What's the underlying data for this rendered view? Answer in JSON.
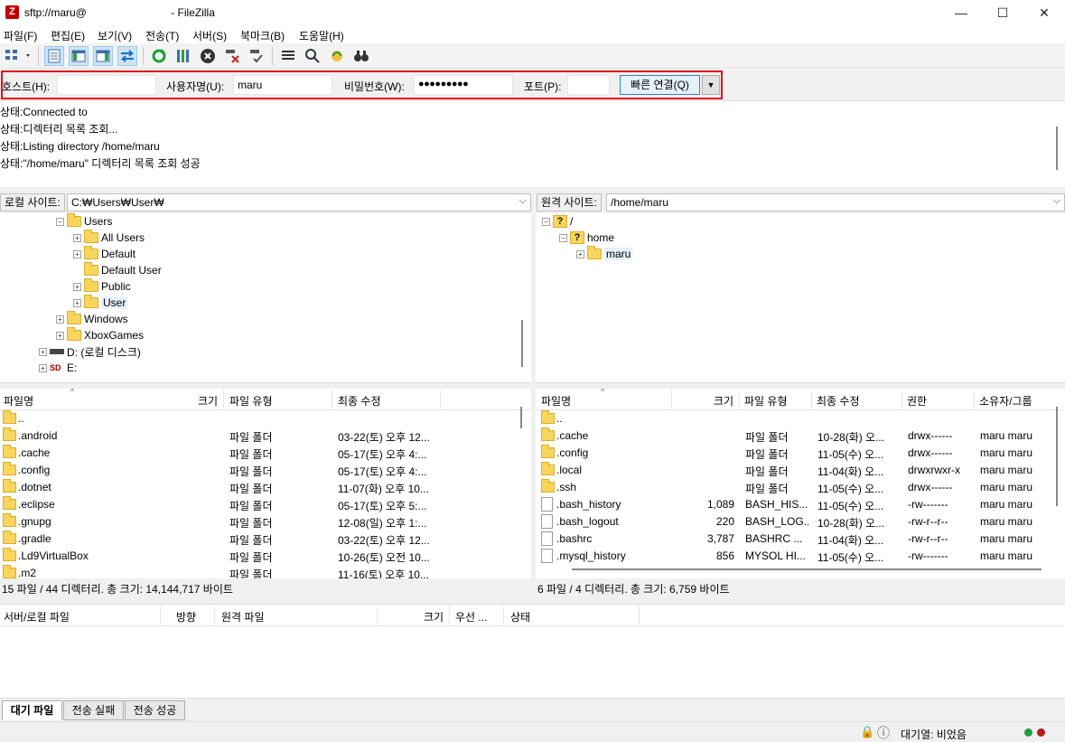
{
  "window": {
    "title_prefix": "sftp://maru@",
    "title_suffix": "- FileZilla",
    "app_icon": "Z",
    "controls": {
      "minimize": "—",
      "maximize": "☐",
      "close": "✕"
    }
  },
  "menu": [
    "파일(F)",
    "편집(E)",
    "보기(V)",
    "전송(T)",
    "서버(S)",
    "북마크(B)",
    "도움말(H)"
  ],
  "quickconnect": {
    "host_label": "호스트(H):",
    "host_value": "",
    "user_label": "사용자명(U):",
    "user_value": "maru",
    "pass_label": "비밀번호(W):",
    "pass_value": "●●●●●●●●●",
    "port_label": "포트(P):",
    "port_value": "",
    "connect_label": "빠른 연결(Q)",
    "dropdown": "▼"
  },
  "log": [
    {
      "prefix": "상태:",
      "text": "Connected to"
    },
    {
      "prefix": "상태:",
      "text": "디렉터리 목록 조회..."
    },
    {
      "prefix": "상태:",
      "text": "Listing directory /home/maru"
    },
    {
      "prefix": "상태:",
      "text": "\"/home/maru\" 디렉터리 목록 조회 성공"
    }
  ],
  "local": {
    "site_label": "로컬 사이트:",
    "site_path": "C:₩Users₩User₩",
    "tree": [
      {
        "label": "Users",
        "expander": "⊟",
        "icon": "folder"
      },
      {
        "label": "All Users",
        "expander": "⊞",
        "icon": "folder-shortcut"
      },
      {
        "label": "Default",
        "expander": "⊞",
        "icon": "folder"
      },
      {
        "label": "Default User",
        "expander": "",
        "icon": "folder-shortcut"
      },
      {
        "label": "Public",
        "expander": "⊞",
        "icon": "folder"
      },
      {
        "label": "User",
        "expander": "⊞",
        "icon": "folder"
      },
      {
        "label": "Windows",
        "expander": "⊞",
        "icon": "folder"
      },
      {
        "label": "XboxGames",
        "expander": "⊞",
        "icon": "folder"
      },
      {
        "label": "D: (로컬 디스크)",
        "expander": "⊞",
        "icon": "drive"
      },
      {
        "label": "E:",
        "expander": "⊞",
        "icon": "sdcard"
      }
    ],
    "columns": [
      "파일명",
      "크기",
      "파일 유형",
      "최종 수정"
    ],
    "files": [
      {
        "name": "..",
        "size": "",
        "type": "",
        "modified": ""
      },
      {
        "name": ".android",
        "size": "",
        "type": "파일 폴더",
        "modified": "03-22(토) 오후 12..."
      },
      {
        "name": ".cache",
        "size": "",
        "type": "파일 폴더",
        "modified": "05-17(토) 오후 4:..."
      },
      {
        "name": ".config",
        "size": "",
        "type": "파일 폴더",
        "modified": "05-17(토) 오후 4:..."
      },
      {
        "name": ".dotnet",
        "size": "",
        "type": "파일 폴더",
        "modified": "11-07(화) 오후 10..."
      },
      {
        "name": ".eclipse",
        "size": "",
        "type": "파일 폴더",
        "modified": "05-17(토) 오후 5:..."
      },
      {
        "name": ".gnupg",
        "size": "",
        "type": "파일 폴더",
        "modified": "12-08(일) 오후 1:..."
      },
      {
        "name": ".gradle",
        "size": "",
        "type": "파일 폴더",
        "modified": "03-22(토) 오후 12..."
      },
      {
        "name": ".Ld9VirtualBox",
        "size": "",
        "type": "파일 폴더",
        "modified": "10-26(토) 오전 10..."
      },
      {
        "name": ".m2",
        "size": "",
        "type": "파일 폴더",
        "modified": "11-16(토) 오후 10..."
      }
    ],
    "status": "15 파일 / 44 디렉터리. 총 크기: 14,144,717 바이트"
  },
  "remote": {
    "site_label": "원격 사이트:",
    "site_path": "/home/maru",
    "tree": [
      {
        "label": "/",
        "expander": "⊟",
        "icon": "unknown"
      },
      {
        "label": "home",
        "expander": "⊟",
        "icon": "unknown"
      },
      {
        "label": "maru",
        "expander": "⊞",
        "icon": "folder"
      }
    ],
    "columns": [
      "파일명",
      "크기",
      "파일 유형",
      "최종 수정",
      "권한",
      "소유자/그룹"
    ],
    "files": [
      {
        "name": "..",
        "size": "",
        "type": "",
        "modified": "",
        "perm": "",
        "owner": "",
        "icon": "folder"
      },
      {
        "name": ".cache",
        "size": "",
        "type": "파일 폴더",
        "modified": "10-28(화) 오...",
        "perm": "drwx------",
        "owner": "maru maru",
        "icon": "folder"
      },
      {
        "name": ".config",
        "size": "",
        "type": "파일 폴더",
        "modified": "11-05(수) 오...",
        "perm": "drwx------",
        "owner": "maru maru",
        "icon": "folder"
      },
      {
        "name": ".local",
        "size": "",
        "type": "파일 폴더",
        "modified": "11-04(화) 오...",
        "perm": "drwxrwxr-x",
        "owner": "maru maru",
        "icon": "folder"
      },
      {
        "name": ".ssh",
        "size": "",
        "type": "파일 폴더",
        "modified": "11-05(수) 오...",
        "perm": "drwx------",
        "owner": "maru maru",
        "icon": "folder"
      },
      {
        "name": ".bash_history",
        "size": "1,089",
        "type": "BASH_HIS...",
        "modified": "11-05(수) 오...",
        "perm": "-rw-------",
        "owner": "maru maru",
        "icon": "doc"
      },
      {
        "name": ".bash_logout",
        "size": "220",
        "type": "BASH_LOG...",
        "modified": "10-28(화) 오...",
        "perm": "-rw-r--r--",
        "owner": "maru maru",
        "icon": "doc"
      },
      {
        "name": ".bashrc",
        "size": "3,787",
        "type": "BASHRC ...",
        "modified": "11-04(화) 오...",
        "perm": "-rw-r--r--",
        "owner": "maru maru",
        "icon": "doc"
      },
      {
        "name": ".mysql_history",
        "size": "856",
        "type": "MYSOL HI...",
        "modified": "11-05(수) 오...",
        "perm": "-rw-------",
        "owner": "maru maru",
        "icon": "doc"
      }
    ],
    "status": "6 파일 / 4 디렉터리. 총 크기: 6,759 바이트"
  },
  "queue": {
    "columns": [
      "서버/로컬 파일",
      "방향",
      "원격 파일",
      "크기",
      "우선 ...",
      "상태"
    ],
    "tabs": [
      "대기 파일",
      "전송 실패",
      "전송 성공"
    ]
  },
  "statusbar": {
    "queue_text": "대기열: 비었음",
    "lock_icon": "🔒",
    "info_icon": "ⓘ"
  },
  "colors": {
    "highlight_border": "#e0121a",
    "folder": "#f8d55d",
    "selected_tool": "#cce4f7",
    "led_green": "#1f9e3a",
    "led_red": "#b81c1c"
  }
}
